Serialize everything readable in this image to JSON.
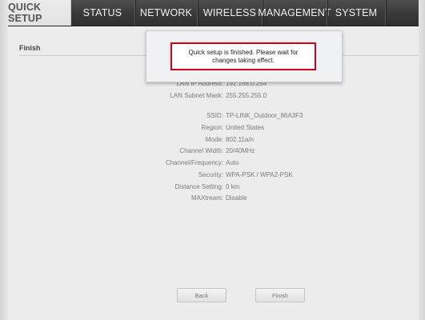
{
  "nav": {
    "tabs": [
      {
        "label": "QUICK SETUP",
        "active": true
      },
      {
        "label": "STATUS",
        "active": false
      },
      {
        "label": "NETWORK",
        "active": false
      },
      {
        "label": "WIRELESS",
        "active": false
      },
      {
        "label": "MANAGEMENT",
        "active": false
      },
      {
        "label": "SYSTEM",
        "active": false
      }
    ]
  },
  "page": {
    "section_title": "Finish"
  },
  "summary": {
    "lan": [
      {
        "label": "LAN IP Address:",
        "value": "192.168.0.254"
      },
      {
        "label": "LAN Subnet Mask:",
        "value": "255.255.255.0"
      }
    ],
    "wireless": [
      {
        "label": "SSID:",
        "value": "TP-LINK_Outdoor_86A3F3"
      },
      {
        "label": "Region:",
        "value": "United States"
      },
      {
        "label": "Mode:",
        "value": "802.11a/n"
      },
      {
        "label": "Channel Width:",
        "value": "20/40MHz"
      },
      {
        "label": "Channel/Frequency:",
        "value": "Auto"
      },
      {
        "label": "Security:",
        "value": "WPA-PSK / WPA2-PSK"
      },
      {
        "label": "Distance Setting:",
        "value": "0 km"
      },
      {
        "label": "MAXtream:",
        "value": "Disable"
      }
    ]
  },
  "buttons": {
    "back_label": "Back",
    "finish_label": "Finish"
  },
  "dialog": {
    "message": "Quick setup is finished. Please wait for changes taking effect."
  },
  "colors": {
    "nav_background": "#3a3a3a",
    "dialog_border_accent": "#d0021b"
  }
}
